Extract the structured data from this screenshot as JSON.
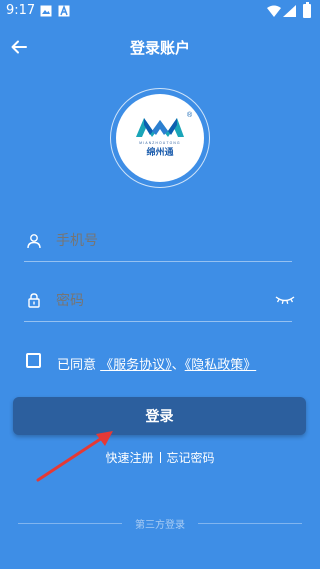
{
  "status_bar": {
    "time": "9:17",
    "notification_icons": [
      "image-icon",
      "text-a-icon"
    ],
    "right_icons": [
      "wifi-icon",
      "signal-icon",
      "battery-icon"
    ]
  },
  "header": {
    "title": "登录账户",
    "back_icon": "arrow-left-icon"
  },
  "logo": {
    "brand_text": "绵州通",
    "tagline": "MIANZHOUTONG",
    "registered_mark": "®"
  },
  "form": {
    "phone": {
      "placeholder": "手机号",
      "icon": "user-icon"
    },
    "password": {
      "placeholder": "密码",
      "icon": "lock-icon",
      "toggle_icon": "eye-closed-icon"
    }
  },
  "agreement": {
    "checked": false,
    "prefix": "已同意",
    "service_link": "《服务协议》",
    "separator": "、",
    "privacy_link": "《隐私政策》"
  },
  "login_button": {
    "label": "登录"
  },
  "links": {
    "register": "快速注册",
    "forgot": "忘记密码"
  },
  "third_party": {
    "label": "第三方登录"
  },
  "colors": {
    "background": "#3e8ee6",
    "button": "#2c5f9e",
    "annotation_arrow": "#e53935"
  }
}
